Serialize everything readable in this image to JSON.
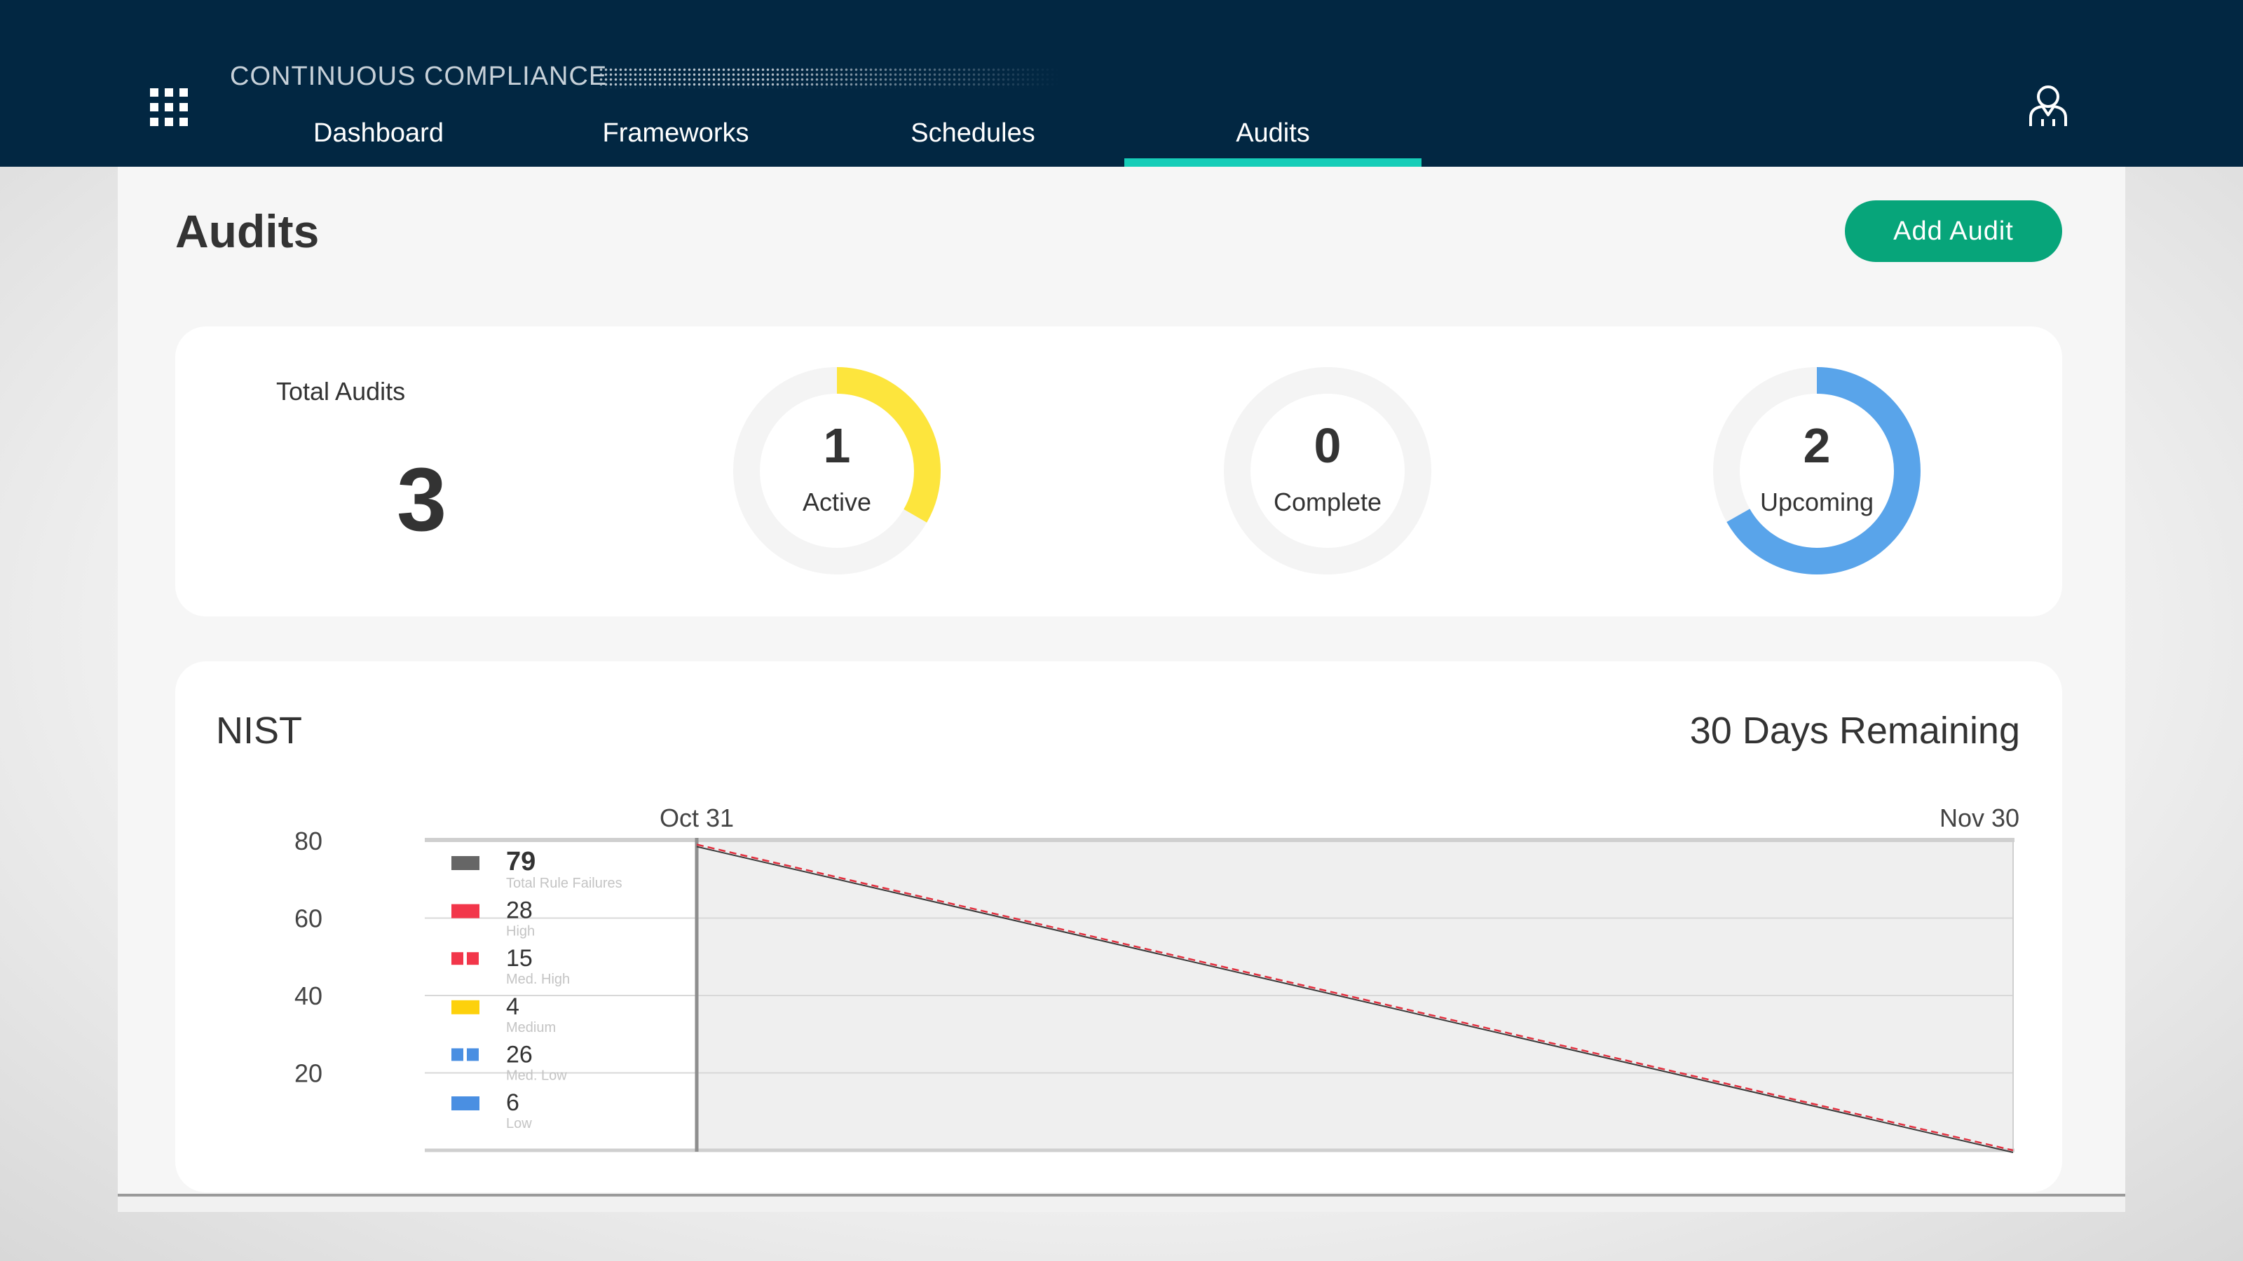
{
  "header": {
    "app_title": "CONTINUOUS COMPLIANCE",
    "tabs": [
      {
        "label": "Dashboard",
        "active": false
      },
      {
        "label": "Frameworks",
        "active": false
      },
      {
        "label": "Schedules",
        "active": false
      },
      {
        "label": "Audits",
        "active": true
      }
    ],
    "icons": {
      "apps": "apps-grid-icon",
      "user": "user-icon"
    },
    "colors": {
      "bar": "#022742",
      "active_tab": "#16cdb8"
    }
  },
  "page": {
    "title": "Audits",
    "add_button_label": "Add Audit",
    "add_button_color": "#07a57a"
  },
  "summary": {
    "total_label": "Total Audits",
    "total_value": "3",
    "rings": [
      {
        "value": "1",
        "label": "Active",
        "color": "#fde53d",
        "fraction": 0.333
      },
      {
        "value": "0",
        "label": "Complete",
        "color": "#eeeeee",
        "fraction": 0
      },
      {
        "value": "2",
        "label": "Upcoming",
        "color": "#59a4ea",
        "fraction": 0.667
      }
    ]
  },
  "nist": {
    "title": "NIST",
    "days_remaining": "30 Days Remaining",
    "legend": [
      {
        "value": "79",
        "label": "Total Rule Failures",
        "color": "#666666",
        "pattern": "solid"
      },
      {
        "value": "28",
        "label": "High",
        "color": "#f2364a",
        "pattern": "solid"
      },
      {
        "value": "15",
        "label": "Med. High",
        "color": "#f2364a",
        "pattern": "split"
      },
      {
        "value": "4",
        "label": "Medium",
        "color": "#fdd10c",
        "pattern": "solid"
      },
      {
        "value": "26",
        "label": "Med. Low",
        "color": "#4a8fe2",
        "pattern": "split"
      },
      {
        "value": "6",
        "label": "Low",
        "color": "#4a8fe2",
        "pattern": "solid"
      }
    ]
  },
  "chart_data": {
    "type": "line",
    "x": [
      "Oct 31",
      "Nov 30"
    ],
    "ylim": [
      0,
      80
    ],
    "yticks": [
      80,
      60,
      40,
      20
    ],
    "series": [
      {
        "values": [
          79,
          0
        ],
        "color": "#e2303f",
        "style": "dashed"
      }
    ],
    "grid": true
  }
}
